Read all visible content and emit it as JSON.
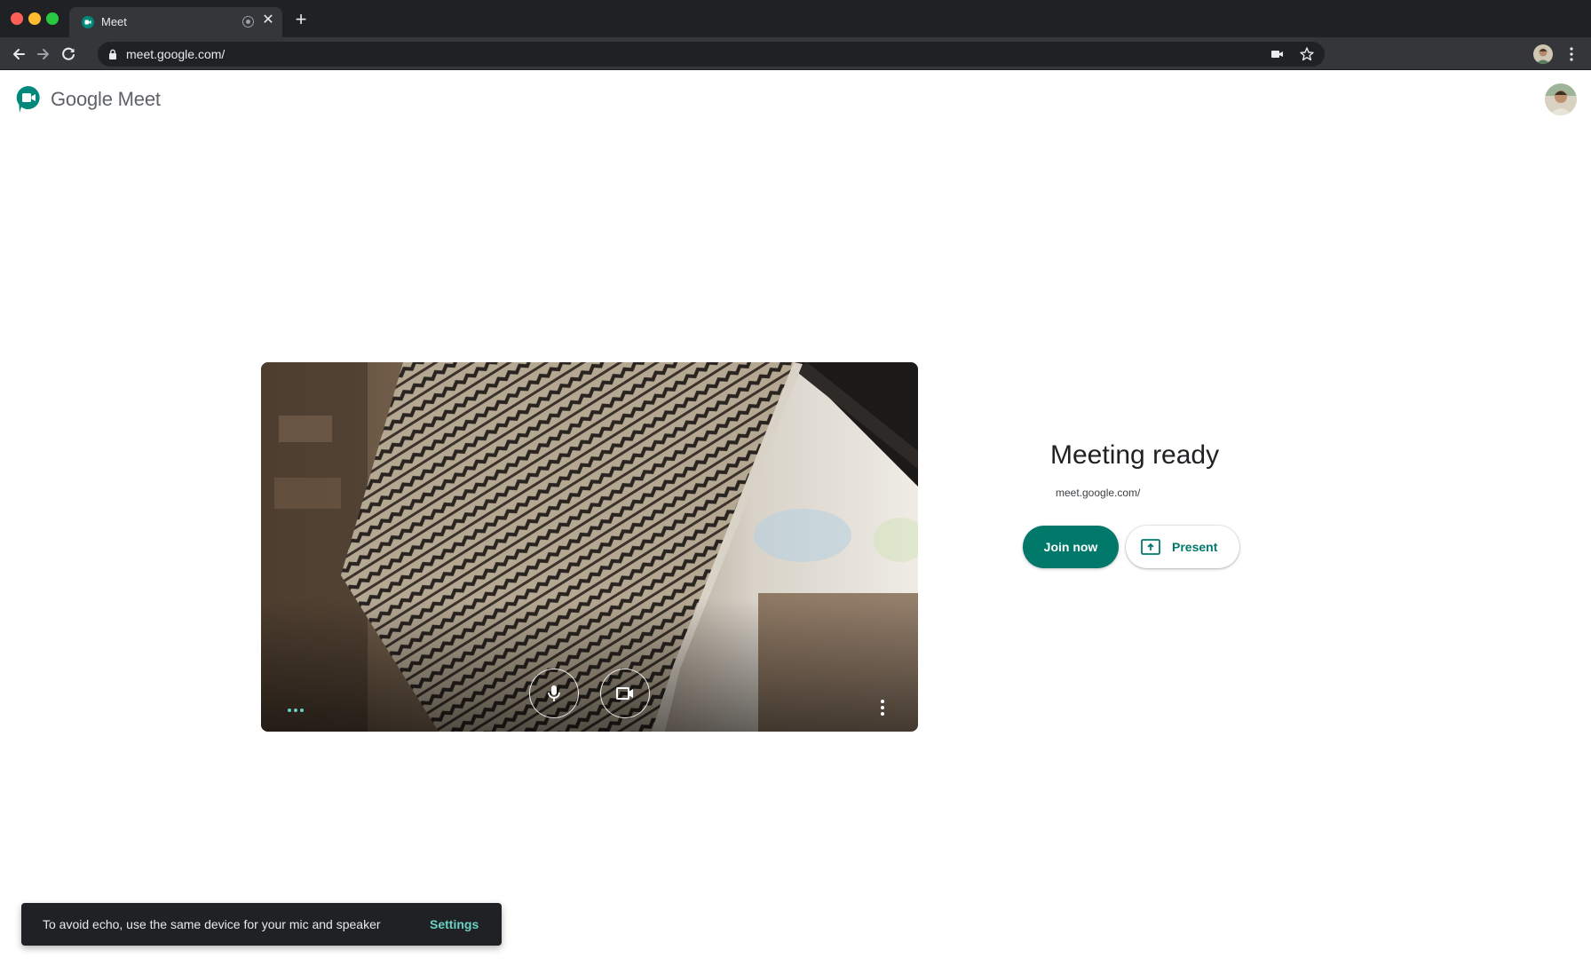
{
  "browser": {
    "tab": {
      "title": "Meet",
      "favicon": "google-meet-icon",
      "media_indicator": "recording-dot-icon",
      "close_glyph": "✕"
    },
    "new_tab_glyph": "+",
    "nav": {
      "back": "arrow-left-icon",
      "forward": "arrow-right-icon",
      "reload": "reload-icon"
    },
    "omnibox": {
      "url": "meet.google.com/",
      "lock": "lock-icon",
      "camera_indicator": "camera-in-use-icon",
      "bookmark": "star-icon"
    },
    "profile": "avatar",
    "menu": "kebab-menu-icon"
  },
  "header": {
    "logo_text": "Google Meet",
    "logo_icon": "google-meet-icon",
    "user_avatar": "avatar"
  },
  "preview": {
    "more_options_icon": "ellipsis-horizontal-icon",
    "mic_icon": "microphone-icon",
    "camera_icon": "video-camera-icon",
    "menu_icon": "kebab-menu-icon"
  },
  "join": {
    "title": "Meeting ready",
    "url": "meet.google.com/",
    "join_label": "Join now",
    "present_label": "Present"
  },
  "snackbar": {
    "message": "To avoid echo, use the same device for your mic and speaker",
    "action": "Settings"
  },
  "colors": {
    "accent": "#00796b",
    "chrome_dark": "#202124",
    "chrome_toolbar": "#35363a",
    "snackbar_action": "#6bd1c4"
  }
}
